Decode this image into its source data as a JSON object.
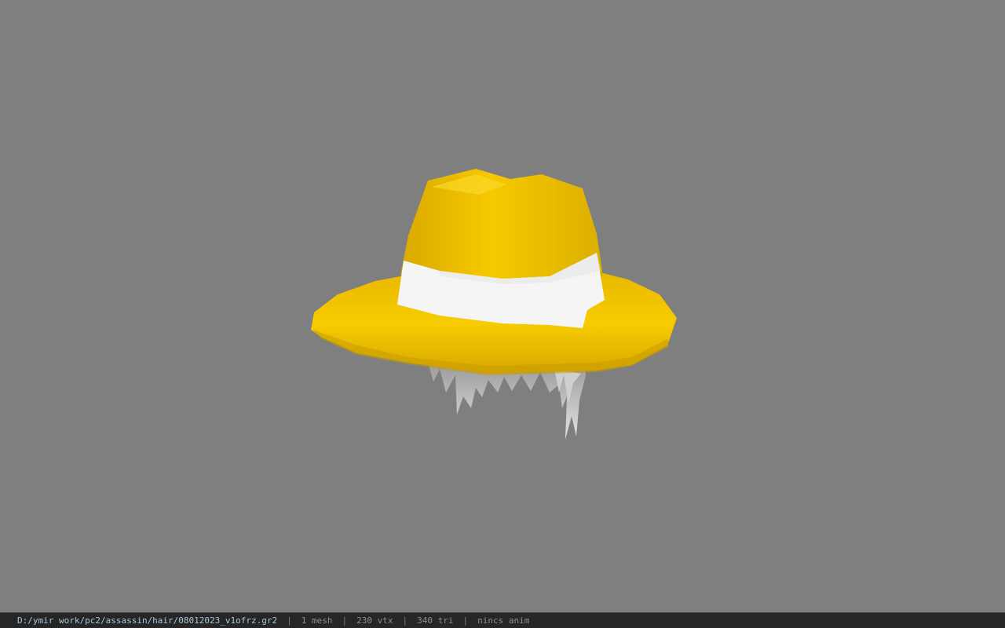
{
  "viewer": {
    "background_color": "#808080",
    "model": "yellow-hat-with-white-band-and-grey-hair"
  },
  "status_bar": {
    "file_path": "D:/ymir work/pc2/assassin/hair/08012023_v1ofrz.gr2",
    "separator": "|",
    "mesh_count": "1 mesh",
    "vertex_count": "230 vtx",
    "triangle_count": "340 tri",
    "animation": "nincs anim"
  },
  "colors": {
    "hat_yellow": "#f2c400",
    "hat_shadow": "#c99b00",
    "band_white": "#f4f4f4",
    "hair_grey": "#d8d8d8"
  }
}
